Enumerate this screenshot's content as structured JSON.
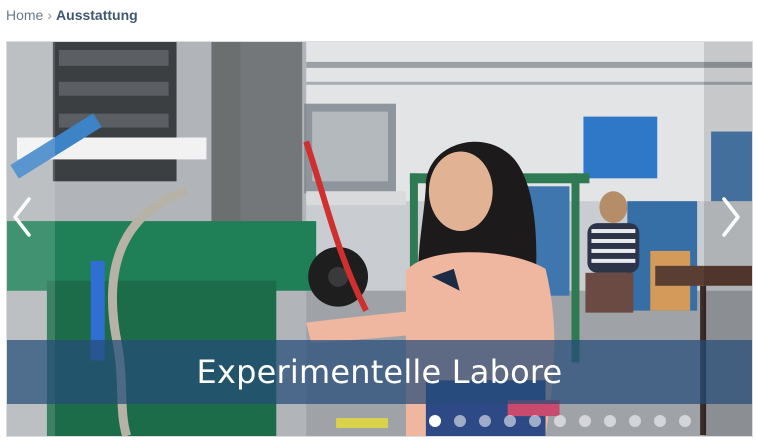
{
  "breadcrumb": {
    "home_label": "Home",
    "separator": "›",
    "current_label": "Ausstattung"
  },
  "slider": {
    "caption": "Experimentelle Labore",
    "slide_count": 11,
    "active_slide_index": 0,
    "prev_icon": "chevron-left-icon",
    "next_icon": "chevron-right-icon"
  },
  "colors": {
    "breadcrumb_text": "#6b7a88",
    "breadcrumb_current": "#3f5872",
    "caption_band": "#264c78",
    "caption_text": "#ffffff",
    "dot_active": "#ffffff"
  }
}
